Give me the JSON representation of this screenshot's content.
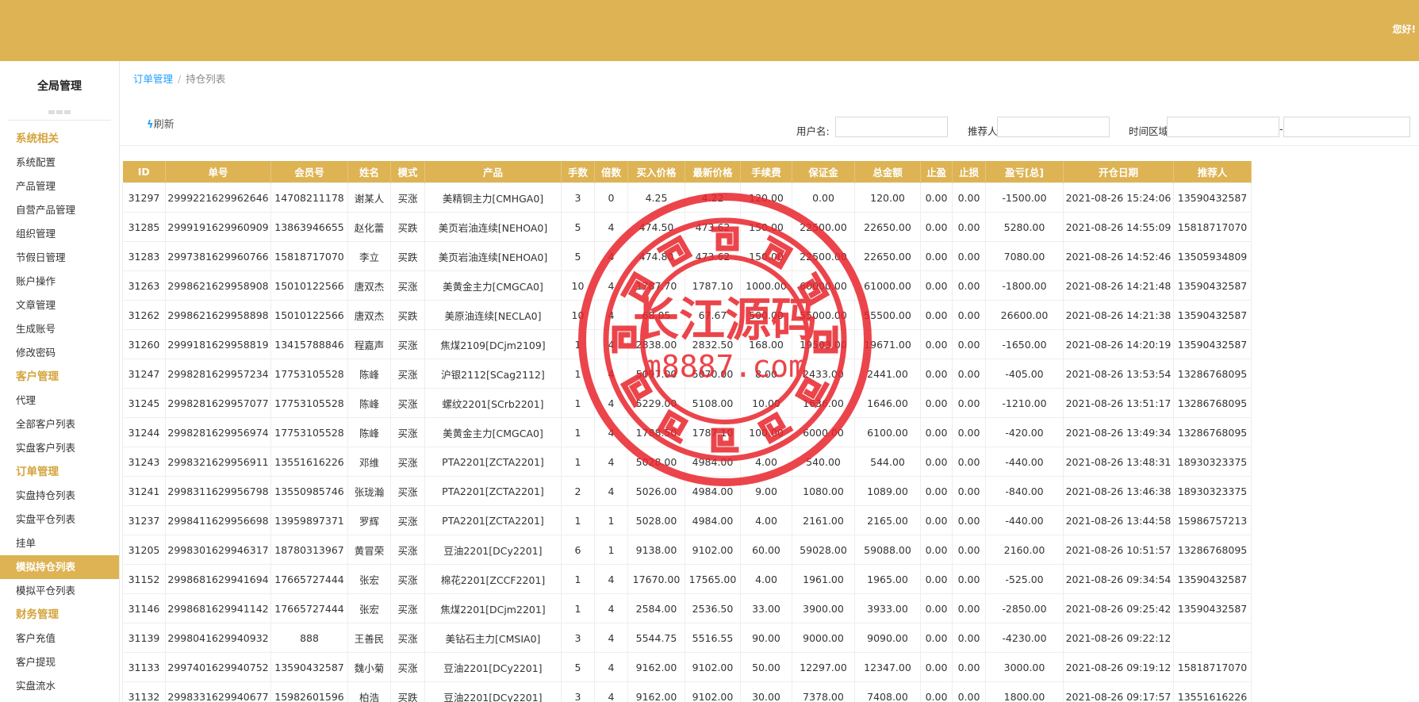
{
  "header": {
    "greeting": "您好!"
  },
  "sidebar": {
    "title": "全局管理",
    "items": [
      {
        "label": "系统相关",
        "type": "group"
      },
      {
        "label": "系统配置",
        "type": "item"
      },
      {
        "label": "产品管理",
        "type": "item"
      },
      {
        "label": "自营产品管理",
        "type": "item"
      },
      {
        "label": "组织管理",
        "type": "item"
      },
      {
        "label": "节假日管理",
        "type": "item"
      },
      {
        "label": "账户操作",
        "type": "item"
      },
      {
        "label": "文章管理",
        "type": "item"
      },
      {
        "label": "生成账号",
        "type": "item"
      },
      {
        "label": "修改密码",
        "type": "item"
      },
      {
        "label": "客户管理",
        "type": "group"
      },
      {
        "label": "代理",
        "type": "item"
      },
      {
        "label": "全部客户列表",
        "type": "item"
      },
      {
        "label": "实盘客户列表",
        "type": "item"
      },
      {
        "label": "订单管理",
        "type": "group"
      },
      {
        "label": "实盘持仓列表",
        "type": "item"
      },
      {
        "label": "实盘平仓列表",
        "type": "item"
      },
      {
        "label": "挂单",
        "type": "item"
      },
      {
        "label": "模拟持仓列表",
        "type": "active"
      },
      {
        "label": "模拟平仓列表",
        "type": "item"
      },
      {
        "label": "财务管理",
        "type": "group"
      },
      {
        "label": "客户充值",
        "type": "item"
      },
      {
        "label": "客户提现",
        "type": "item"
      },
      {
        "label": "实盘流水",
        "type": "item"
      }
    ]
  },
  "breadcrumb": {
    "parent": "订单管理",
    "separator": "/",
    "current": "持仓列表"
  },
  "toolbar": {
    "refresh_label": "刷新"
  },
  "filters": {
    "username_label": "用户名:",
    "referrer_label": "推荐人:",
    "time_range_label": "时间区域",
    "range_separator": "-"
  },
  "table": {
    "columns": [
      "ID",
      "单号",
      "会员号",
      "姓名",
      "模式",
      "产品",
      "手数",
      "倍数",
      "买入价格",
      "最新价格",
      "手续费",
      "保证金",
      "总金额",
      "止盈",
      "止损",
      "盈亏[总]",
      "开仓日期",
      "推荐人"
    ],
    "rows": [
      [
        "31297",
        "2999221629962646",
        "14708211178",
        "谢某人",
        "买涨",
        "美精铜主力[CMHGA0]",
        "3",
        "0",
        "4.25",
        "4.22",
        "120.00",
        "0.00",
        "120.00",
        "0.00",
        "0.00",
        "-1500.00",
        "2021-08-26 15:24:06",
        "13590432587"
      ],
      [
        "31285",
        "2999191629960909",
        "13863946655",
        "赵化蕾",
        "买跌",
        "美页岩油连续[NEHOA0]",
        "5",
        "4",
        "474.50",
        "473.62",
        "150.00",
        "22500.00",
        "22650.00",
        "0.00",
        "0.00",
        "5280.00",
        "2021-08-26 14:55:09",
        "15818717070"
      ],
      [
        "31283",
        "2997381629960766",
        "15818717070",
        "李立",
        "买跌",
        "美页岩油连续[NEHOA0]",
        "5",
        "4",
        "474.80",
        "473.62",
        "150.00",
        "22500.00",
        "22650.00",
        "0.00",
        "0.00",
        "7080.00",
        "2021-08-26 14:52:46",
        "13505934809"
      ],
      [
        "31263",
        "2998621629958908",
        "15010122566",
        "唐双杰",
        "买涨",
        "美黄金主力[CMGCA0]",
        "10",
        "4",
        "1787.70",
        "1787.10",
        "1000.00",
        "60000.00",
        "61000.00",
        "0.00",
        "0.00",
        "-1800.00",
        "2021-08-26 14:21:48",
        "13590432587"
      ],
      [
        "31262",
        "2998621629958898",
        "15010122566",
        "唐双杰",
        "买跌",
        "美原油连续[NECLA0]",
        "10",
        "4",
        "68.05",
        "67.67",
        "500.00",
        "55000.00",
        "55500.00",
        "0.00",
        "0.00",
        "26600.00",
        "2021-08-26 14:21:38",
        "13590432587"
      ],
      [
        "31260",
        "2999181629958819",
        "13415788846",
        "程嘉声",
        "买涨",
        "焦煤2109[DCjm2109]",
        "1",
        "4",
        "2838.00",
        "2832.50",
        "168.00",
        "19503.00",
        "19671.00",
        "0.00",
        "0.00",
        "-1650.00",
        "2021-08-26 14:20:19",
        "13590432587"
      ],
      [
        "31247",
        "2998281629957234",
        "17753105528",
        "陈峰",
        "买涨",
        "沪银2112[SCag2112]",
        "1",
        "4",
        "5097.00",
        "5070.00",
        "8.00",
        "2433.00",
        "2441.00",
        "0.00",
        "0.00",
        "-405.00",
        "2021-08-26 13:53:54",
        "13286768095"
      ],
      [
        "31245",
        "2998281629957077",
        "17753105528",
        "陈峰",
        "买涨",
        "螺纹2201[SCrb2201]",
        "1",
        "4",
        "5229.00",
        "5108.00",
        "10.00",
        "1636.00",
        "1646.00",
        "0.00",
        "0.00",
        "-1210.00",
        "2021-08-26 13:51:17",
        "13286768095"
      ],
      [
        "31244",
        "2998281629956974",
        "17753105528",
        "陈峰",
        "买涨",
        "美黄金主力[CMGCA0]",
        "1",
        "4",
        "1788.50",
        "1787.10",
        "100.00",
        "6000.00",
        "6100.00",
        "0.00",
        "0.00",
        "-420.00",
        "2021-08-26 13:49:34",
        "13286768095"
      ],
      [
        "31243",
        "2998321629956911",
        "13551616226",
        "邓维",
        "买涨",
        "PTA2201[ZCTA2201]",
        "1",
        "4",
        "5028.00",
        "4984.00",
        "4.00",
        "540.00",
        "544.00",
        "0.00",
        "0.00",
        "-440.00",
        "2021-08-26 13:48:31",
        "18930323375"
      ],
      [
        "31241",
        "2998311629956798",
        "13550985746",
        "张珑瀚",
        "买涨",
        "PTA2201[ZCTA2201]",
        "2",
        "4",
        "5026.00",
        "4984.00",
        "9.00",
        "1080.00",
        "1089.00",
        "0.00",
        "0.00",
        "-840.00",
        "2021-08-26 13:46:38",
        "18930323375"
      ],
      [
        "31237",
        "2998411629956698",
        "13959897371",
        "罗辉",
        "买涨",
        "PTA2201[ZCTA2201]",
        "1",
        "1",
        "5028.00",
        "4984.00",
        "4.00",
        "2161.00",
        "2165.00",
        "0.00",
        "0.00",
        "-440.00",
        "2021-08-26 13:44:58",
        "15986757213"
      ],
      [
        "31205",
        "2998301629946317",
        "18780313967",
        "黄冒荣",
        "买涨",
        "豆油2201[DCy2201]",
        "6",
        "1",
        "9138.00",
        "9102.00",
        "60.00",
        "59028.00",
        "59088.00",
        "0.00",
        "0.00",
        "2160.00",
        "2021-08-26 10:51:57",
        "13286768095"
      ],
      [
        "31152",
        "2998681629941694",
        "17665727444",
        "张宏",
        "买涨",
        "棉花2201[ZCCF2201]",
        "1",
        "4",
        "17670.00",
        "17565.00",
        "4.00",
        "1961.00",
        "1965.00",
        "0.00",
        "0.00",
        "-525.00",
        "2021-08-26 09:34:54",
        "13590432587"
      ],
      [
        "31146",
        "2998681629941142",
        "17665727444",
        "张宏",
        "买涨",
        "焦煤2201[DCjm2201]",
        "1",
        "4",
        "2584.00",
        "2536.50",
        "33.00",
        "3900.00",
        "3933.00",
        "0.00",
        "0.00",
        "-2850.00",
        "2021-08-26 09:25:42",
        "13590432587"
      ],
      [
        "31139",
        "2998041629940932",
        "888",
        "王善民",
        "买涨",
        "美钻石主力[CMSIA0]",
        "3",
        "4",
        "5544.75",
        "5516.55",
        "90.00",
        "9000.00",
        "9090.00",
        "0.00",
        "0.00",
        "-4230.00",
        "2021-08-26 09:22:12",
        ""
      ],
      [
        "31133",
        "2997401629940752",
        "13590432587",
        "魏小菊",
        "买涨",
        "豆油2201[DCy2201]",
        "5",
        "4",
        "9162.00",
        "9102.00",
        "50.00",
        "12297.00",
        "12347.00",
        "0.00",
        "0.00",
        "3000.00",
        "2021-08-26 09:19:12",
        "15818717070"
      ],
      [
        "31132",
        "2998331629940677",
        "15982601596",
        "柏浩",
        "买跌",
        "豆油2201[DCy2201]",
        "3",
        "4",
        "9162.00",
        "9102.00",
        "30.00",
        "7378.00",
        "7408.00",
        "0.00",
        "0.00",
        "1800.00",
        "2021-08-26 09:17:57",
        "13551616226"
      ]
    ]
  },
  "watermark": {
    "title": "长江源码",
    "site": "m8887.com",
    "color": "#e8252c"
  }
}
